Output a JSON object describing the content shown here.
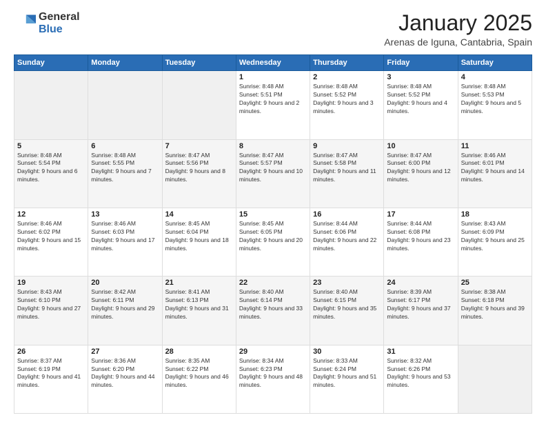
{
  "logo": {
    "general": "General",
    "blue": "Blue"
  },
  "header": {
    "month": "January 2025",
    "location": "Arenas de Iguna, Cantabria, Spain"
  },
  "days_of_week": [
    "Sunday",
    "Monday",
    "Tuesday",
    "Wednesday",
    "Thursday",
    "Friday",
    "Saturday"
  ],
  "weeks": [
    [
      {
        "day": "",
        "info": ""
      },
      {
        "day": "",
        "info": ""
      },
      {
        "day": "",
        "info": ""
      },
      {
        "day": "1",
        "info": "Sunrise: 8:48 AM\nSunset: 5:51 PM\nDaylight: 9 hours and 2 minutes."
      },
      {
        "day": "2",
        "info": "Sunrise: 8:48 AM\nSunset: 5:52 PM\nDaylight: 9 hours and 3 minutes."
      },
      {
        "day": "3",
        "info": "Sunrise: 8:48 AM\nSunset: 5:52 PM\nDaylight: 9 hours and 4 minutes."
      },
      {
        "day": "4",
        "info": "Sunrise: 8:48 AM\nSunset: 5:53 PM\nDaylight: 9 hours and 5 minutes."
      }
    ],
    [
      {
        "day": "5",
        "info": "Sunrise: 8:48 AM\nSunset: 5:54 PM\nDaylight: 9 hours and 6 minutes."
      },
      {
        "day": "6",
        "info": "Sunrise: 8:48 AM\nSunset: 5:55 PM\nDaylight: 9 hours and 7 minutes."
      },
      {
        "day": "7",
        "info": "Sunrise: 8:47 AM\nSunset: 5:56 PM\nDaylight: 9 hours and 8 minutes."
      },
      {
        "day": "8",
        "info": "Sunrise: 8:47 AM\nSunset: 5:57 PM\nDaylight: 9 hours and 10 minutes."
      },
      {
        "day": "9",
        "info": "Sunrise: 8:47 AM\nSunset: 5:58 PM\nDaylight: 9 hours and 11 minutes."
      },
      {
        "day": "10",
        "info": "Sunrise: 8:47 AM\nSunset: 6:00 PM\nDaylight: 9 hours and 12 minutes."
      },
      {
        "day": "11",
        "info": "Sunrise: 8:46 AM\nSunset: 6:01 PM\nDaylight: 9 hours and 14 minutes."
      }
    ],
    [
      {
        "day": "12",
        "info": "Sunrise: 8:46 AM\nSunset: 6:02 PM\nDaylight: 9 hours and 15 minutes."
      },
      {
        "day": "13",
        "info": "Sunrise: 8:46 AM\nSunset: 6:03 PM\nDaylight: 9 hours and 17 minutes."
      },
      {
        "day": "14",
        "info": "Sunrise: 8:45 AM\nSunset: 6:04 PM\nDaylight: 9 hours and 18 minutes."
      },
      {
        "day": "15",
        "info": "Sunrise: 8:45 AM\nSunset: 6:05 PM\nDaylight: 9 hours and 20 minutes."
      },
      {
        "day": "16",
        "info": "Sunrise: 8:44 AM\nSunset: 6:06 PM\nDaylight: 9 hours and 22 minutes."
      },
      {
        "day": "17",
        "info": "Sunrise: 8:44 AM\nSunset: 6:08 PM\nDaylight: 9 hours and 23 minutes."
      },
      {
        "day": "18",
        "info": "Sunrise: 8:43 AM\nSunset: 6:09 PM\nDaylight: 9 hours and 25 minutes."
      }
    ],
    [
      {
        "day": "19",
        "info": "Sunrise: 8:43 AM\nSunset: 6:10 PM\nDaylight: 9 hours and 27 minutes."
      },
      {
        "day": "20",
        "info": "Sunrise: 8:42 AM\nSunset: 6:11 PM\nDaylight: 9 hours and 29 minutes."
      },
      {
        "day": "21",
        "info": "Sunrise: 8:41 AM\nSunset: 6:13 PM\nDaylight: 9 hours and 31 minutes."
      },
      {
        "day": "22",
        "info": "Sunrise: 8:40 AM\nSunset: 6:14 PM\nDaylight: 9 hours and 33 minutes."
      },
      {
        "day": "23",
        "info": "Sunrise: 8:40 AM\nSunset: 6:15 PM\nDaylight: 9 hours and 35 minutes."
      },
      {
        "day": "24",
        "info": "Sunrise: 8:39 AM\nSunset: 6:17 PM\nDaylight: 9 hours and 37 minutes."
      },
      {
        "day": "25",
        "info": "Sunrise: 8:38 AM\nSunset: 6:18 PM\nDaylight: 9 hours and 39 minutes."
      }
    ],
    [
      {
        "day": "26",
        "info": "Sunrise: 8:37 AM\nSunset: 6:19 PM\nDaylight: 9 hours and 41 minutes."
      },
      {
        "day": "27",
        "info": "Sunrise: 8:36 AM\nSunset: 6:20 PM\nDaylight: 9 hours and 44 minutes."
      },
      {
        "day": "28",
        "info": "Sunrise: 8:35 AM\nSunset: 6:22 PM\nDaylight: 9 hours and 46 minutes."
      },
      {
        "day": "29",
        "info": "Sunrise: 8:34 AM\nSunset: 6:23 PM\nDaylight: 9 hours and 48 minutes."
      },
      {
        "day": "30",
        "info": "Sunrise: 8:33 AM\nSunset: 6:24 PM\nDaylight: 9 hours and 51 minutes."
      },
      {
        "day": "31",
        "info": "Sunrise: 8:32 AM\nSunset: 6:26 PM\nDaylight: 9 hours and 53 minutes."
      },
      {
        "day": "",
        "info": ""
      }
    ]
  ]
}
